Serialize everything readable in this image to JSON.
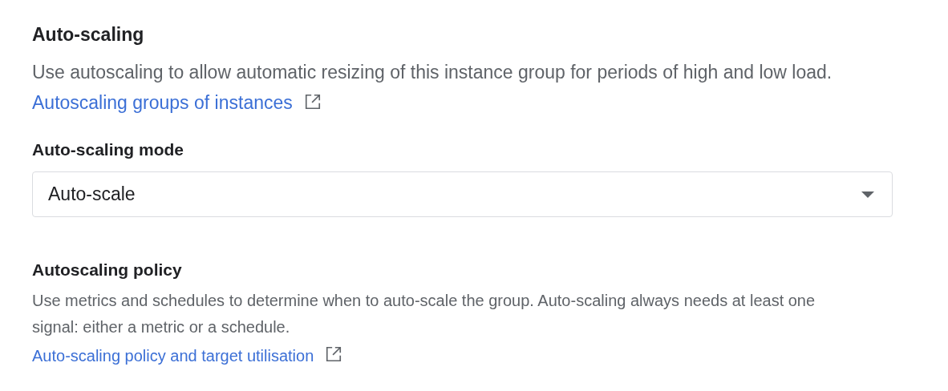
{
  "autoscaling": {
    "title": "Auto-scaling",
    "description": "Use autoscaling to allow automatic resizing of this instance group for periods of high and low load.",
    "link": "Autoscaling groups of instances"
  },
  "mode": {
    "label": "Auto-scaling mode",
    "value": "Auto-scale"
  },
  "policy": {
    "title": "Autoscaling policy",
    "description": "Use metrics and schedules to determine when to auto-scale the group. Auto-scaling always needs at least one signal: either a metric or a schedule.",
    "link": "Auto-scaling policy and target utilisation"
  }
}
